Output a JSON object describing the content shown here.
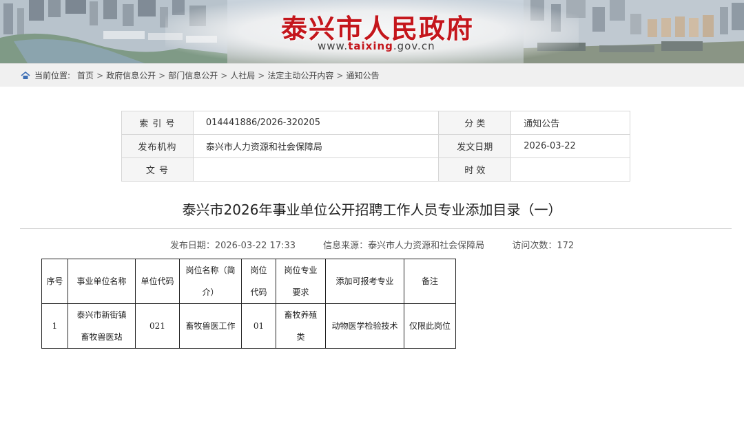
{
  "header": {
    "site_title": "泰兴市人民政府",
    "site_url_prefix": "www.",
    "site_url_domain": "taixing",
    "site_url_suffix": ".gov.cn"
  },
  "breadcrumb": {
    "label": "当前位置:",
    "items": [
      "首页",
      "政府信息公开",
      "部门信息公开",
      "人社局",
      "法定主动公开内容",
      "通知公告"
    ],
    "separator": ">"
  },
  "meta": {
    "index_label": "索 引 号",
    "index_value": "014441886/2026-320205",
    "category_label": "分 类",
    "category_value": "通知公告",
    "publisher_label": "发布机构",
    "publisher_value": "泰兴市人力资源和社会保障局",
    "issue_date_label": "发文日期",
    "issue_date_value": "2026-03-22",
    "doc_no_label": "文 号",
    "doc_no_value": "",
    "validity_label": "时 效",
    "validity_value": ""
  },
  "article": {
    "title": "泰兴市2026年事业单位公开招聘工作人员专业添加目录（一）",
    "publish_date": "发布日期：2026-03-22 17:33",
    "source": "信息来源：泰兴市人力资源和社会保障局",
    "views": "访问次数：172"
  },
  "table": {
    "headers": [
      [
        "序号"
      ],
      [
        "事业单位名称"
      ],
      [
        "单位代码"
      ],
      [
        "岗位名称（简",
        "介）"
      ],
      [
        "岗位",
        "代码"
      ],
      [
        "岗位专业",
        "要求"
      ],
      [
        "添加可报考专业"
      ],
      [
        "备注"
      ]
    ],
    "rows": [
      [
        [
          "1"
        ],
        [
          "泰兴市新街镇",
          "畜牧兽医站"
        ],
        [
          "021"
        ],
        [
          "畜牧兽医工作"
        ],
        [
          "01"
        ],
        [
          "畜牧养殖",
          "类"
        ],
        [
          "动物医学检验技术"
        ],
        [
          "仅限此岗位"
        ]
      ]
    ]
  }
}
